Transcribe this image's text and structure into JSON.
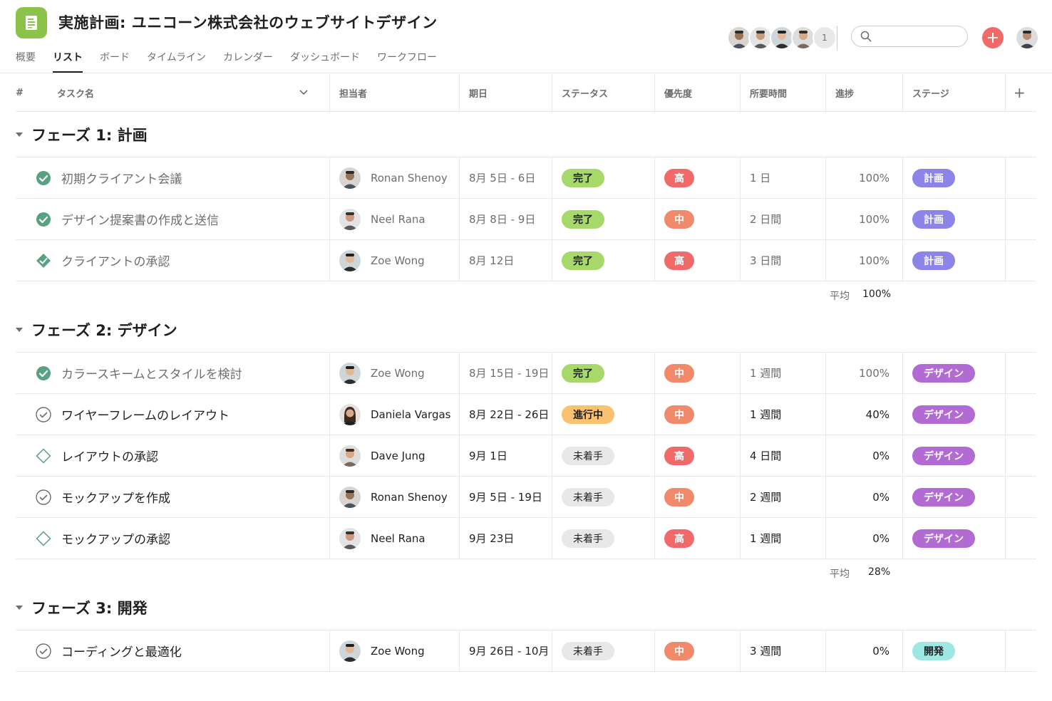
{
  "header": {
    "title": "実施計画: ユニコーン株式会社のウェブサイトデザイン",
    "tabs": [
      {
        "label": "概要",
        "active": false
      },
      {
        "label": "リスト",
        "active": true
      },
      {
        "label": "ボード",
        "active": false
      },
      {
        "label": "タイムライン",
        "active": false
      },
      {
        "label": "カレンダー",
        "active": false
      },
      {
        "label": "ダッシュボード",
        "active": false
      },
      {
        "label": "ワークフロー",
        "active": false
      }
    ],
    "member_overflow": "1",
    "search_placeholder": ""
  },
  "columns": {
    "num": "#",
    "task": "タスク名",
    "assignee": "担当者",
    "due": "期日",
    "status": "ステータス",
    "priority": "優先度",
    "duration": "所要時間",
    "progress": "進捗",
    "stage": "ステージ",
    "add": "+"
  },
  "sections": [
    {
      "title": "フェーズ 1: 計画",
      "avg_label": "平均",
      "avg_value": "100%",
      "tasks": [
        {
          "name": "初期クライアント会議",
          "assignee": "Ronan Shenoy",
          "due": "8月 5日 - 6日",
          "status": "完了",
          "priority": "高",
          "duration": "1 日",
          "progress": "100%",
          "stage": "計画"
        },
        {
          "name": "デザイン提案書の作成と送信",
          "assignee": "Neel Rana",
          "due": "8月 8日 - 9日",
          "status": "完了",
          "priority": "中",
          "duration": "2 日間",
          "progress": "100%",
          "stage": "計画"
        },
        {
          "name": "クライアントの承認",
          "assignee": "Zoe Wong",
          "due": "8月 12日",
          "status": "完了",
          "priority": "高",
          "duration": "3 日間",
          "progress": "100%",
          "stage": "計画"
        }
      ]
    },
    {
      "title": "フェーズ 2: デザイン",
      "avg_label": "平均",
      "avg_value": "28%",
      "tasks": [
        {
          "name": "カラースキームとスタイルを検討",
          "assignee": "Zoe Wong",
          "due": "8月 15日 - 19日",
          "status": "完了",
          "priority": "中",
          "duration": "1 週間",
          "progress": "100%",
          "stage": "デザイン"
        },
        {
          "name": "ワイヤーフレームのレイアウト",
          "assignee": "Daniela Vargas",
          "due": "8月 22日 - 26日",
          "status": "進行中",
          "priority": "中",
          "duration": "1 週間",
          "progress": "40%",
          "stage": "デザイン"
        },
        {
          "name": "レイアウトの承認",
          "assignee": "Dave Jung",
          "due": "9月 1日",
          "status": "未着手",
          "priority": "高",
          "duration": "4 日間",
          "progress": "0%",
          "stage": "デザイン"
        },
        {
          "name": "モックアップを作成",
          "assignee": "Ronan Shenoy",
          "due": "9月 5日 - 19日",
          "status": "未着手",
          "priority": "中",
          "duration": "2 週間",
          "progress": "0%",
          "stage": "デザイン"
        },
        {
          "name": "モックアップの承認",
          "assignee": "Neel Rana",
          "due": "9月 23日",
          "status": "未着手",
          "priority": "高",
          "duration": "1 週間",
          "progress": "0%",
          "stage": "デザイン"
        }
      ]
    },
    {
      "title": "フェーズ 3: 開発",
      "tasks": [
        {
          "name": "コーディングと最適化",
          "assignee": "Zoe Wong",
          "due": "9月 26日 - 10月",
          "status": "未着手",
          "priority": "中",
          "duration": "3 週間",
          "progress": "0%",
          "stage": "開発"
        }
      ]
    }
  ],
  "colors": {
    "accent_red": "#f06a6a",
    "done_green": "#a6d96a",
    "in_progress": "#f9c170",
    "stage_plan": "#8d84e8",
    "stage_design": "#b36bd4",
    "stage_dev": "#9ee7e3",
    "check_green": "#58a182"
  }
}
